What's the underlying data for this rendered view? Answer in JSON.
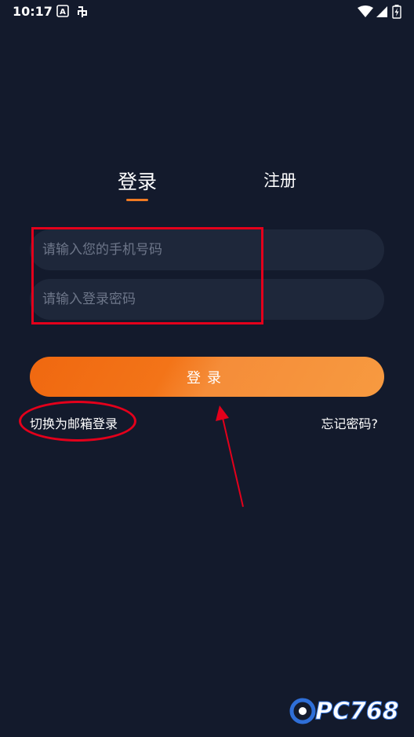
{
  "status_bar": {
    "time": "10:17",
    "icons": [
      "a-notification-icon",
      "app-notification-icon",
      "wifi-icon",
      "signal-icon",
      "battery-icon"
    ]
  },
  "tabs": {
    "login": "登录",
    "register": "注册"
  },
  "form": {
    "phone_placeholder": "请输入您的手机号码",
    "password_placeholder": "请输入登录密码"
  },
  "login_button": "登录",
  "switch_to_email": "切换为邮箱登录",
  "forgot_password": "忘记密码?",
  "watermark": {
    "text": "PC768",
    "colors": {
      "logo": "#2f6fd8",
      "text": "#ffffff"
    }
  },
  "colors": {
    "background": "#131a2c",
    "accent": "#f07a22",
    "field_bg": "#1e273a",
    "annotation": "#e3001b"
  }
}
